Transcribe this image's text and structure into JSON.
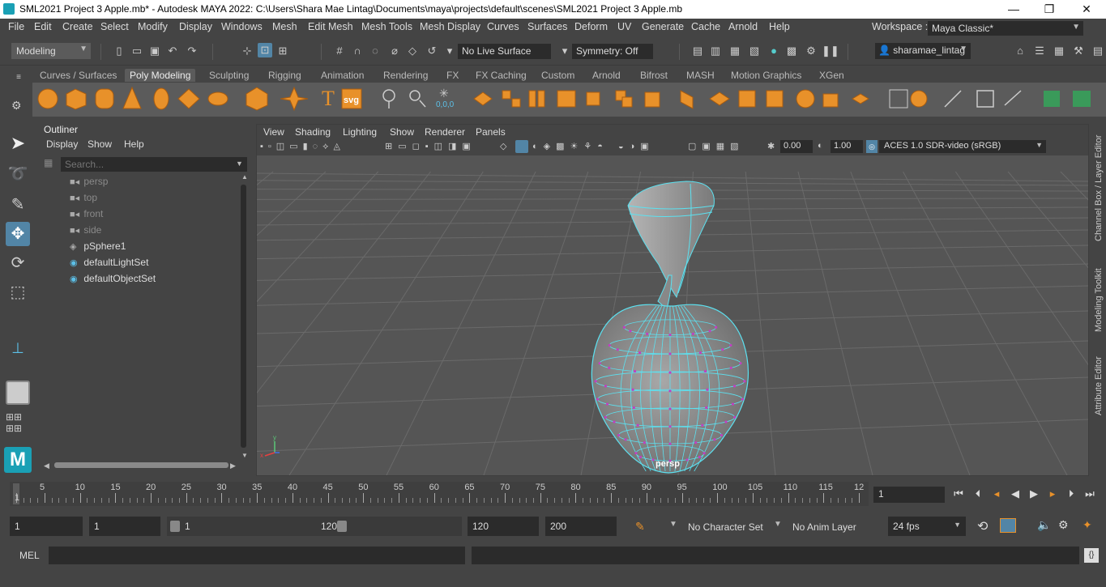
{
  "window": {
    "title": "SML2021 Project 3 Apple.mb* - Autodesk MAYA 2022: C:\\Users\\Shara Mae Lintag\\Documents\\maya\\projects\\default\\scenes\\SML2021 Project 3 Apple.mb",
    "minimize": "—",
    "restore": "❐",
    "close": "✕"
  },
  "menubar": {
    "items": [
      "File",
      "Edit",
      "Create",
      "Select",
      "Modify",
      "Display",
      "Windows",
      "Mesh",
      "Edit Mesh",
      "Mesh Tools",
      "Mesh Display",
      "Curves",
      "Surfaces",
      "Deform",
      "UV",
      "Generate",
      "Cache",
      "Arnold",
      "Help"
    ],
    "workspace_label": "Workspace :",
    "workspace_value": "Maya Classic*"
  },
  "statusline": {
    "menuset": "Modeling",
    "live_surface": "No Live Surface",
    "symmetry": "Symmetry: Off",
    "user": "sharamae_lintag"
  },
  "shelf": {
    "tabs": [
      "Curves / Surfaces",
      "Poly Modeling",
      "Sculpting",
      "Rigging",
      "Animation",
      "Rendering",
      "FX",
      "FX Caching",
      "Custom",
      "Arnold",
      "Bifrost",
      "MASH",
      "Motion Graphics",
      "XGen"
    ],
    "active_tab": "Poly Modeling",
    "svg_label": "svg",
    "coord_label": "0,0,0"
  },
  "outliner": {
    "title": "Outliner",
    "menu": [
      "Display",
      "Show",
      "Help"
    ],
    "search_placeholder": "Search...",
    "items": [
      {
        "label": "persp",
        "icon": "camera-icon",
        "dim": true
      },
      {
        "label": "top",
        "icon": "camera-icon",
        "dim": true
      },
      {
        "label": "front",
        "icon": "camera-icon",
        "dim": true
      },
      {
        "label": "side",
        "icon": "camera-icon",
        "dim": true
      },
      {
        "label": "pSphere1",
        "icon": "mesh-icon",
        "dim": false
      },
      {
        "label": "defaultLightSet",
        "icon": "set-icon",
        "dim": false
      },
      {
        "label": "defaultObjectSet",
        "icon": "set-icon",
        "dim": false
      }
    ]
  },
  "viewport": {
    "menu": [
      "View",
      "Shading",
      "Lighting",
      "Show",
      "Renderer",
      "Panels"
    ],
    "exposure": "0.00",
    "gamma": "1.00",
    "colorspace": "ACES 1.0 SDR-video (sRGB)",
    "camera_label": "persp",
    "axis_x": "x",
    "axis_y": "y"
  },
  "side_panels": [
    "Channel Box / Layer Editor",
    "Modeling Toolkit",
    "Attribute Editor"
  ],
  "timeslider": {
    "ticks": [
      "1",
      "5",
      "10",
      "15",
      "20",
      "25",
      "30",
      "35",
      "40",
      "45",
      "50",
      "55",
      "60",
      "65",
      "70",
      "75",
      "80",
      "85",
      "90",
      "95",
      "100",
      "105",
      "110",
      "115",
      "12"
    ],
    "current_frame": "1"
  },
  "range": {
    "start": "1",
    "playback_start": "1",
    "slider_start": "1",
    "slider_end": "120",
    "playback_end": "120",
    "end": "200",
    "character_set": "No Character Set",
    "anim_layer": "No Anim Layer",
    "fps": "24 fps"
  },
  "cmdline": {
    "label": "MEL"
  },
  "colors": {
    "accent": "#5285a6",
    "wire": "#5ce1f0",
    "vertex": "#c040c0",
    "shelf_orange": "#e8912a"
  }
}
